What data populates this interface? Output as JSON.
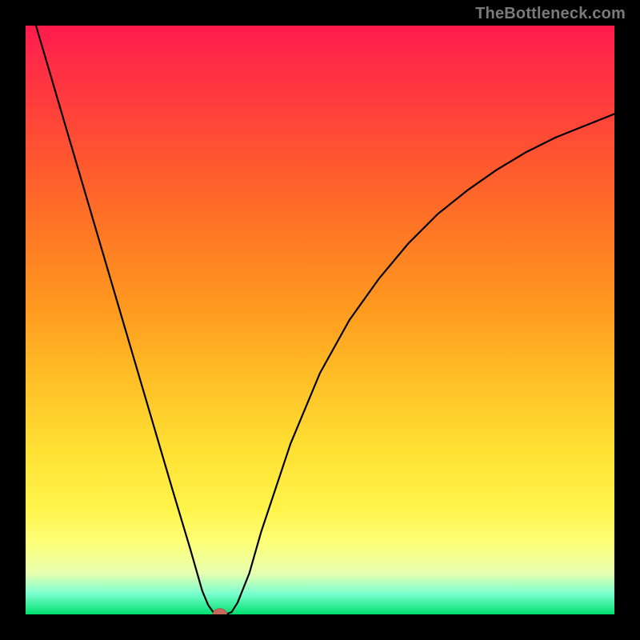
{
  "watermark": "TheBottleneck.com",
  "colors": {
    "background": "#000000",
    "curve": "#000000",
    "marker_fill": "#c56a5a",
    "marker_stroke": "#b05048"
  },
  "chart_data": {
    "type": "line",
    "title": "",
    "xlabel": "",
    "ylabel": "",
    "xlim": [
      0,
      100
    ],
    "ylim": [
      0,
      100
    ],
    "grid": false,
    "legend": false,
    "x": [
      0,
      5,
      10,
      15,
      20,
      25,
      28,
      30,
      31,
      32,
      33,
      34,
      35,
      36,
      38,
      40,
      45,
      50,
      55,
      60,
      65,
      70,
      75,
      80,
      85,
      90,
      95,
      100
    ],
    "values": [
      106,
      89,
      72,
      55,
      38,
      21,
      11,
      4,
      1.6,
      0.2,
      0,
      0,
      0.4,
      2,
      7,
      14,
      29,
      41,
      50,
      57,
      63,
      68,
      72,
      75.5,
      78.5,
      81,
      83,
      85
    ],
    "marker": {
      "x": 33,
      "y": 0,
      "rx": 1.2,
      "ry": 1.0
    }
  }
}
